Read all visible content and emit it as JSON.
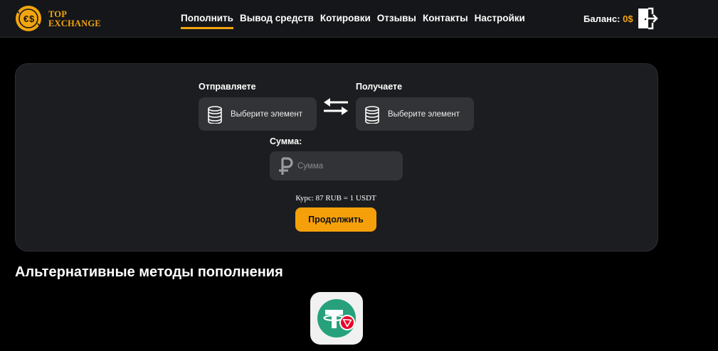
{
  "header": {
    "brand_line1": "TOP",
    "brand_line2": "EXCHANGE",
    "nav": [
      {
        "label": "Пополнить",
        "active": true
      },
      {
        "label": "Вывод средств"
      },
      {
        "label": "Котировки"
      },
      {
        "label": "Отзывы"
      },
      {
        "label": "Контакты"
      },
      {
        "label": "Настройки"
      }
    ],
    "balance_label": "Баланс:",
    "balance_value": "0$"
  },
  "exchange": {
    "send_label": "Отправляете",
    "send_placeholder": "Выберите элемент",
    "receive_label": "Получаете",
    "receive_placeholder": "Выберите элемент",
    "amount_label": "Сумма:",
    "amount_placeholder": "Сумма",
    "rate": "Курс: 87 RUB = 1 USDT",
    "continue_label": "Продолжить"
  },
  "alt_methods": {
    "title": "Альтернативные методы пополнения",
    "methods": [
      {
        "icon": "usdt-trc20-icon"
      }
    ]
  },
  "colors": {
    "accent": "#f2a50f",
    "background": "#000000",
    "header": "#151619",
    "panel": "#1c1d20",
    "input": "#323336"
  }
}
